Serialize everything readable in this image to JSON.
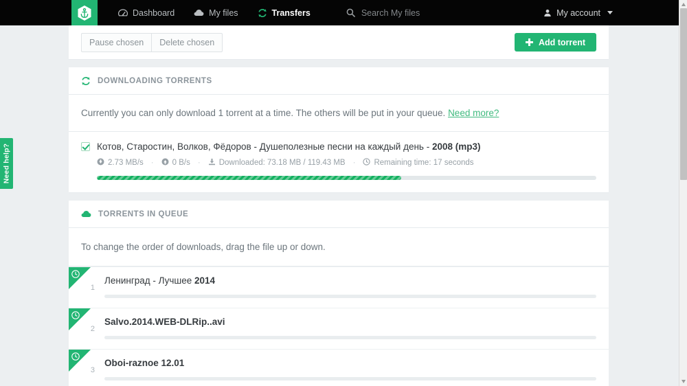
{
  "navbar": {
    "logo_icon": "anchor-hexagon-logo",
    "links": [
      {
        "label": "Dashboard",
        "icon": "dashboard-icon",
        "active": false
      },
      {
        "label": "My files",
        "icon": "cloud-icon",
        "active": false
      },
      {
        "label": "Transfers",
        "icon": "refresh-sync-icon",
        "active": true
      }
    ],
    "search": {
      "icon": "search-icon",
      "placeholder": "Search My files",
      "value": ""
    },
    "account": {
      "label": "My account",
      "icon": "user-icon",
      "caret": "chevron-down-icon"
    }
  },
  "toolbar": {
    "pause_label": "Pause chosen",
    "delete_label": "Delete chosen",
    "add_torrent_label": "Add torrent",
    "add_icon": "plus-icon"
  },
  "downloading": {
    "section_icon": "refresh-sync-icon",
    "section_title": "DOWNLOADING TORRENTS",
    "notice_text": "Currently you can only download 1 torrent at a time. The others will be put in your queue.",
    "notice_link": "Need more?",
    "torrent": {
      "checked": true,
      "title_main": "Котов, Старостин, Волков, Фёдоров - Душеполезные песни на каждый день - ",
      "title_bold": "2008 (mp3)",
      "download_speed": "2.73 MB/s",
      "download_icon": "download-arrow-circle-icon",
      "upload_speed": "0 B/s",
      "upload_icon": "upload-arrow-circle-icon",
      "downloaded_icon": "download-tray-icon",
      "downloaded_label": "Downloaded: 73.18 MB / 119.43 MB",
      "remaining_icon": "clock-icon",
      "remaining_label": "Remaining time: 17 seconds",
      "progress_percent": 61
    }
  },
  "queue": {
    "section_icon": "cloud-icon",
    "section_title": "TORRENTS IN QUEUE",
    "note": "To change the order of downloads, drag the file up or down.",
    "items": [
      {
        "number": "1",
        "name_regular": "Ленинград - Лучшее ",
        "name_bold": "2014",
        "badge_icon": "clock-icon"
      },
      {
        "number": "2",
        "name_regular": "",
        "name_bold": "Salvo.2014.WEB-DLRip..avi",
        "badge_icon": "clock-icon"
      },
      {
        "number": "3",
        "name_regular": "",
        "name_bold": "Oboi-raznoe 12.01",
        "badge_icon": "clock-icon"
      }
    ]
  },
  "help_tab": {
    "label": "Need help?"
  },
  "colors": {
    "accent_green": "#22b573",
    "navbar_black": "#050505",
    "page_background": "#eceff1",
    "progress_green": "#12b05f"
  }
}
